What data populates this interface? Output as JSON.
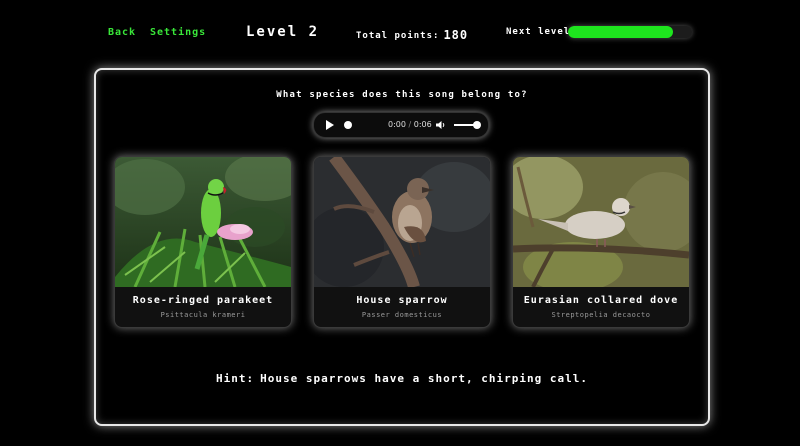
{
  "nav": {
    "back": "Back",
    "settings": "Settings"
  },
  "header": {
    "level": "Level 2",
    "points_label": "Total points:",
    "points_value": "180",
    "next_level_label": "Next level:",
    "next_level_progress": 0.85
  },
  "question": "What species does this song belong to?",
  "audio": {
    "current": "0:00",
    "duration": "0:06"
  },
  "options": [
    {
      "name": "Rose-ringed parakeet",
      "scientific": "Psittacula krameri"
    },
    {
      "name": "House sparrow",
      "scientific": "Passer domesticus"
    },
    {
      "name": "Eurasian collared dove",
      "scientific": "Streptopelia decaocto"
    }
  ],
  "hint": {
    "label": "Hint:",
    "text": "House sparrows have a short, chirping call."
  },
  "colors": {
    "accent": "#39e639",
    "progress": "#1ee51e",
    "background": "#000000"
  }
}
